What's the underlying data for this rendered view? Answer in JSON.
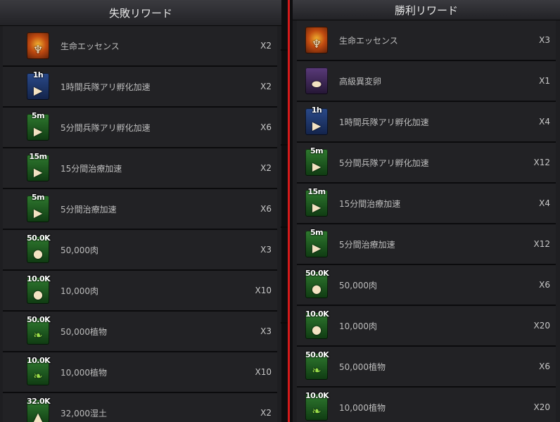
{
  "left": {
    "title": "失敗リワード",
    "items": [
      {
        "tag": "",
        "icon": "essence-icon",
        "color": "orange",
        "glyph": "♆",
        "label": "生命エッセンス",
        "qty": "X2"
      },
      {
        "tag": "1h",
        "icon": "troop-hatch-speedup-icon",
        "color": "blue",
        "glyph": "▶",
        "label": "1時間兵隊アリ孵化加速",
        "qty": "X2"
      },
      {
        "tag": "5m",
        "icon": "troop-hatch-speedup-icon",
        "color": "green",
        "glyph": "▶",
        "label": "5分間兵隊アリ孵化加速",
        "qty": "X6"
      },
      {
        "tag": "15m",
        "icon": "heal-speedup-icon",
        "color": "green",
        "glyph": "▶",
        "label": "15分間治療加速",
        "qty": "X2"
      },
      {
        "tag": "5m",
        "icon": "heal-speedup-icon",
        "color": "green",
        "glyph": "▶",
        "label": "5分間治療加速",
        "qty": "X6"
      },
      {
        "tag": "50.0K",
        "icon": "meat-icon",
        "color": "green",
        "glyph": "●",
        "label": "50,000肉",
        "qty": "X3"
      },
      {
        "tag": "10.0K",
        "icon": "meat-icon",
        "color": "green",
        "glyph": "●",
        "label": "10,000肉",
        "qty": "X10"
      },
      {
        "tag": "50.0K",
        "icon": "plant-icon",
        "color": "green",
        "glyph": "❧",
        "label": "50,000植物",
        "qty": "X3"
      },
      {
        "tag": "10.0K",
        "icon": "plant-icon",
        "color": "green",
        "glyph": "❧",
        "label": "10,000植物",
        "qty": "X10"
      },
      {
        "tag": "32.0K",
        "icon": "wet-soil-icon",
        "color": "green",
        "glyph": "▲",
        "label": "32,000湿土",
        "qty": "X2"
      }
    ]
  },
  "right": {
    "title": "勝利リワード",
    "items": [
      {
        "tag": "",
        "icon": "essence-icon",
        "color": "orange",
        "glyph": "♆",
        "label": "生命エッセンス",
        "qty": "X3"
      },
      {
        "tag": "",
        "icon": "mutant-egg-icon",
        "color": "purple",
        "glyph": "⬬",
        "label": "高級異変卵",
        "qty": "X1"
      },
      {
        "tag": "1h",
        "icon": "troop-hatch-speedup-icon",
        "color": "blue",
        "glyph": "▶",
        "label": "1時間兵隊アリ孵化加速",
        "qty": "X4"
      },
      {
        "tag": "5m",
        "icon": "troop-hatch-speedup-icon",
        "color": "green",
        "glyph": "▶",
        "label": "5分間兵隊アリ孵化加速",
        "qty": "X12"
      },
      {
        "tag": "15m",
        "icon": "heal-speedup-icon",
        "color": "green",
        "glyph": "▶",
        "label": "15分間治療加速",
        "qty": "X4"
      },
      {
        "tag": "5m",
        "icon": "heal-speedup-icon",
        "color": "green",
        "glyph": "▶",
        "label": "5分間治療加速",
        "qty": "X12"
      },
      {
        "tag": "50.0K",
        "icon": "meat-icon",
        "color": "green",
        "glyph": "●",
        "label": "50,000肉",
        "qty": "X6"
      },
      {
        "tag": "10.0K",
        "icon": "meat-icon",
        "color": "green",
        "glyph": "●",
        "label": "10,000肉",
        "qty": "X20"
      },
      {
        "tag": "50.0K",
        "icon": "plant-icon",
        "color": "green",
        "glyph": "❧",
        "label": "50,000植物",
        "qty": "X6"
      },
      {
        "tag": "10.0K",
        "icon": "plant-icon",
        "color": "green",
        "glyph": "❧",
        "label": "10,000植物",
        "qty": "X20"
      }
    ]
  }
}
